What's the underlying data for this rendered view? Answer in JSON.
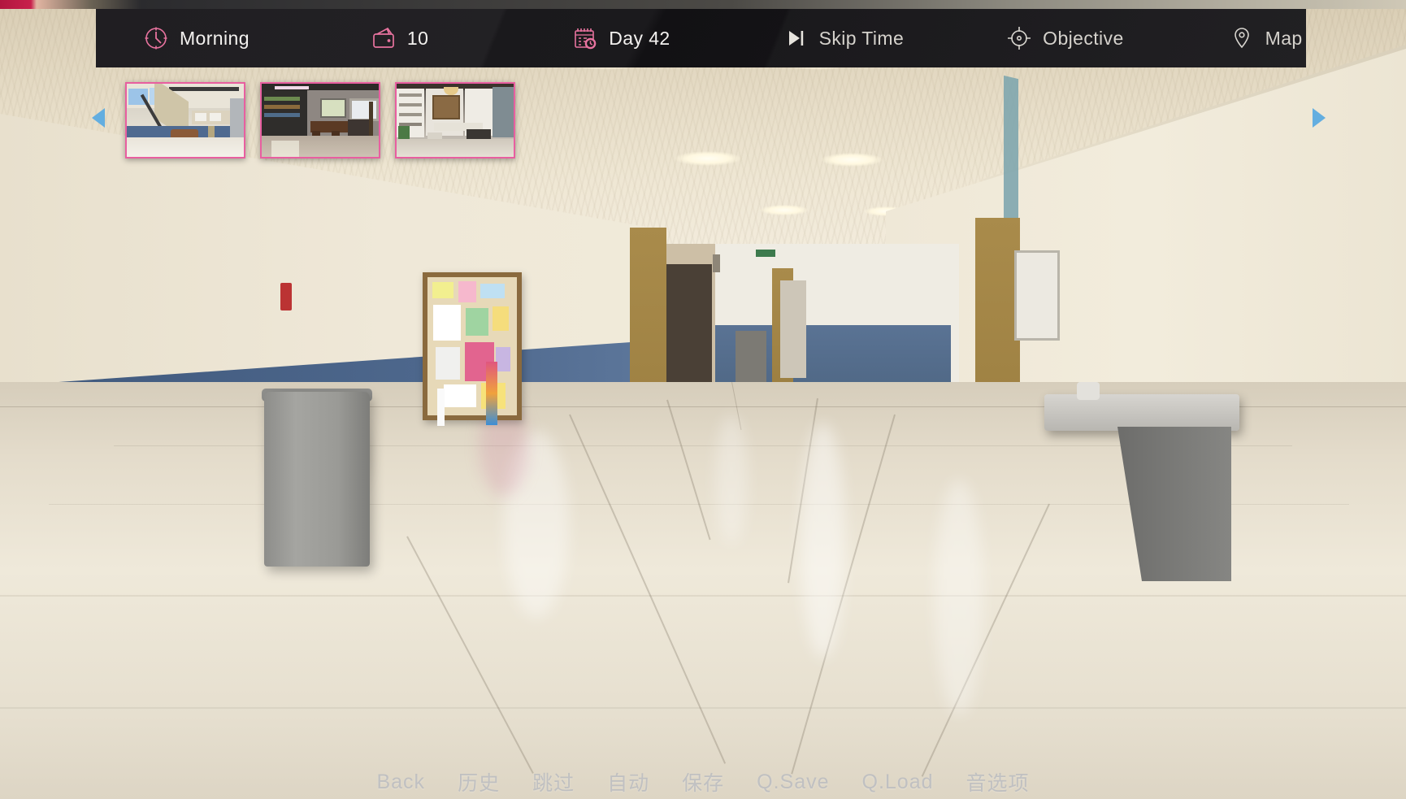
{
  "hud": {
    "items": [
      {
        "icon": "clock-icon",
        "label": "Morning",
        "group": "pink"
      },
      {
        "icon": "wallet-icon",
        "label": "10",
        "group": "pink"
      },
      {
        "icon": "calendar-icon",
        "label": "Day 42",
        "group": "pink"
      },
      {
        "icon": "skip-icon",
        "label": "Skip Time",
        "group": "grey"
      },
      {
        "icon": "objective-icon",
        "label": "Objective",
        "group": "grey"
      },
      {
        "icon": "map-pin-icon",
        "label": "Map",
        "group": "grey"
      }
    ]
  },
  "gallery": {
    "prev_arrow": "left-arrow-icon",
    "next_arrow": "right-arrow-icon",
    "thumbnails": [
      {
        "name": "location-thumbnail-atrium"
      },
      {
        "name": "location-thumbnail-dining-room"
      },
      {
        "name": "location-thumbnail-study"
      }
    ]
  },
  "bottom_menu": {
    "items": [
      {
        "label": "Back"
      },
      {
        "label": "历史"
      },
      {
        "label": "跳过"
      },
      {
        "label": "自动"
      },
      {
        "label": "保存"
      },
      {
        "label": "Q.Save"
      },
      {
        "label": "Q.Load"
      },
      {
        "label": "音选项"
      }
    ]
  },
  "scene": {
    "name": "school-hallway-background"
  },
  "colors": {
    "accent_pink": "#e85fa0",
    "hud_background": "#18161a",
    "hud_text": "#f3f1ef",
    "arrow_blue": "#63aee0",
    "wall_blue": "#4e688d"
  }
}
